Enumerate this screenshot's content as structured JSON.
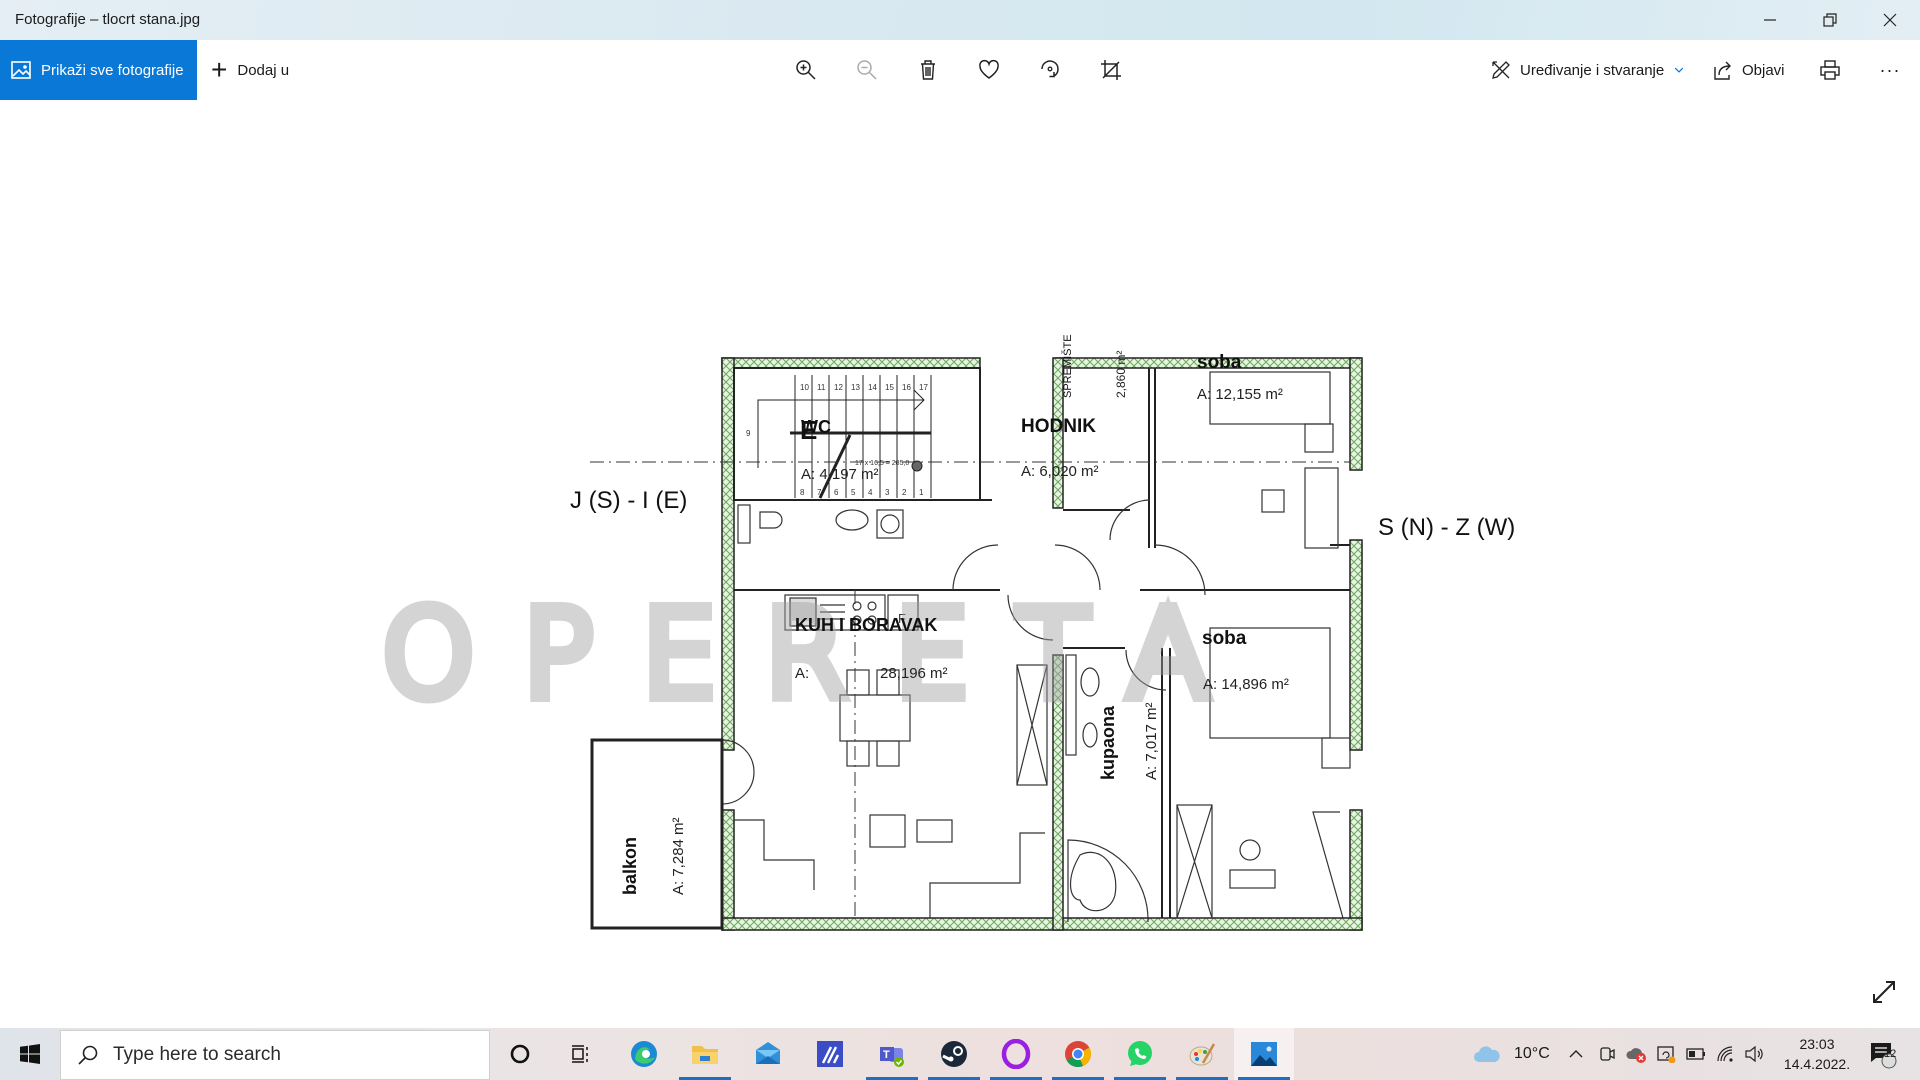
{
  "window": {
    "title": "Fotografije – tlocrt stana.jpg",
    "controls": [
      "minimize",
      "restore",
      "close"
    ]
  },
  "toolbar": {
    "show_all_label": "Prikaži sve fotografije",
    "add_to_label": "Dodaj u",
    "tools": [
      {
        "name": "zoom-in",
        "enabled": true
      },
      {
        "name": "zoom-out",
        "enabled": false
      },
      {
        "name": "delete",
        "enabled": true
      },
      {
        "name": "favorite",
        "enabled": true
      },
      {
        "name": "rotate",
        "enabled": true
      },
      {
        "name": "crop",
        "enabled": true
      }
    ],
    "edit_create_label": "Uređivanje i stvaranje",
    "share_label": "Objavi",
    "print_label": "Print",
    "more_label": "···"
  },
  "floorplan": {
    "watermark": "OPERETA",
    "direction_left": "J (S) - I (E)",
    "direction_right": "S (N) - Z (W)",
    "entrance_marker": "E",
    "rooms": [
      {
        "name": "WC",
        "area": "A: 4,197 m²"
      },
      {
        "name": "HODNIK",
        "area": "A: 6,020 m²"
      },
      {
        "name": "SPREMIŠTE",
        "area": "2,860 m²"
      },
      {
        "name": "soba",
        "area": "A: 12,155 m²"
      },
      {
        "name": "KUH I BORAVAK",
        "area_prefix": "A:",
        "area": "28,196 m²"
      },
      {
        "name": "kupaona",
        "area": "A: 7,017 m²"
      },
      {
        "name": "soba",
        "area": "A: 14,896 m²"
      },
      {
        "name": "balkon",
        "area": "A: 7,284 m²"
      }
    ],
    "stair_numbers_top": [
      "10",
      "11",
      "12",
      "13",
      "14",
      "15",
      "16",
      "17"
    ],
    "stair_numbers_bottom": [
      "8",
      "7",
      "6",
      "5",
      "4",
      "3",
      "2",
      "1"
    ],
    "stair_number_side": "9",
    "stair_note": "17 x 16,5 = 285,0",
    "kitchen_fridge": "F"
  },
  "taskbar": {
    "search_placeholder": "Type here to search",
    "apps": [
      "cortana",
      "task-view",
      "edge",
      "file-explorer",
      "mail",
      "affinity",
      "teams",
      "steam",
      "opera",
      "chrome",
      "whatsapp",
      "paint",
      "photos"
    ],
    "weather": "10°C",
    "time": "23:03",
    "date": "14.4.2022.",
    "notifications_count": "12"
  }
}
